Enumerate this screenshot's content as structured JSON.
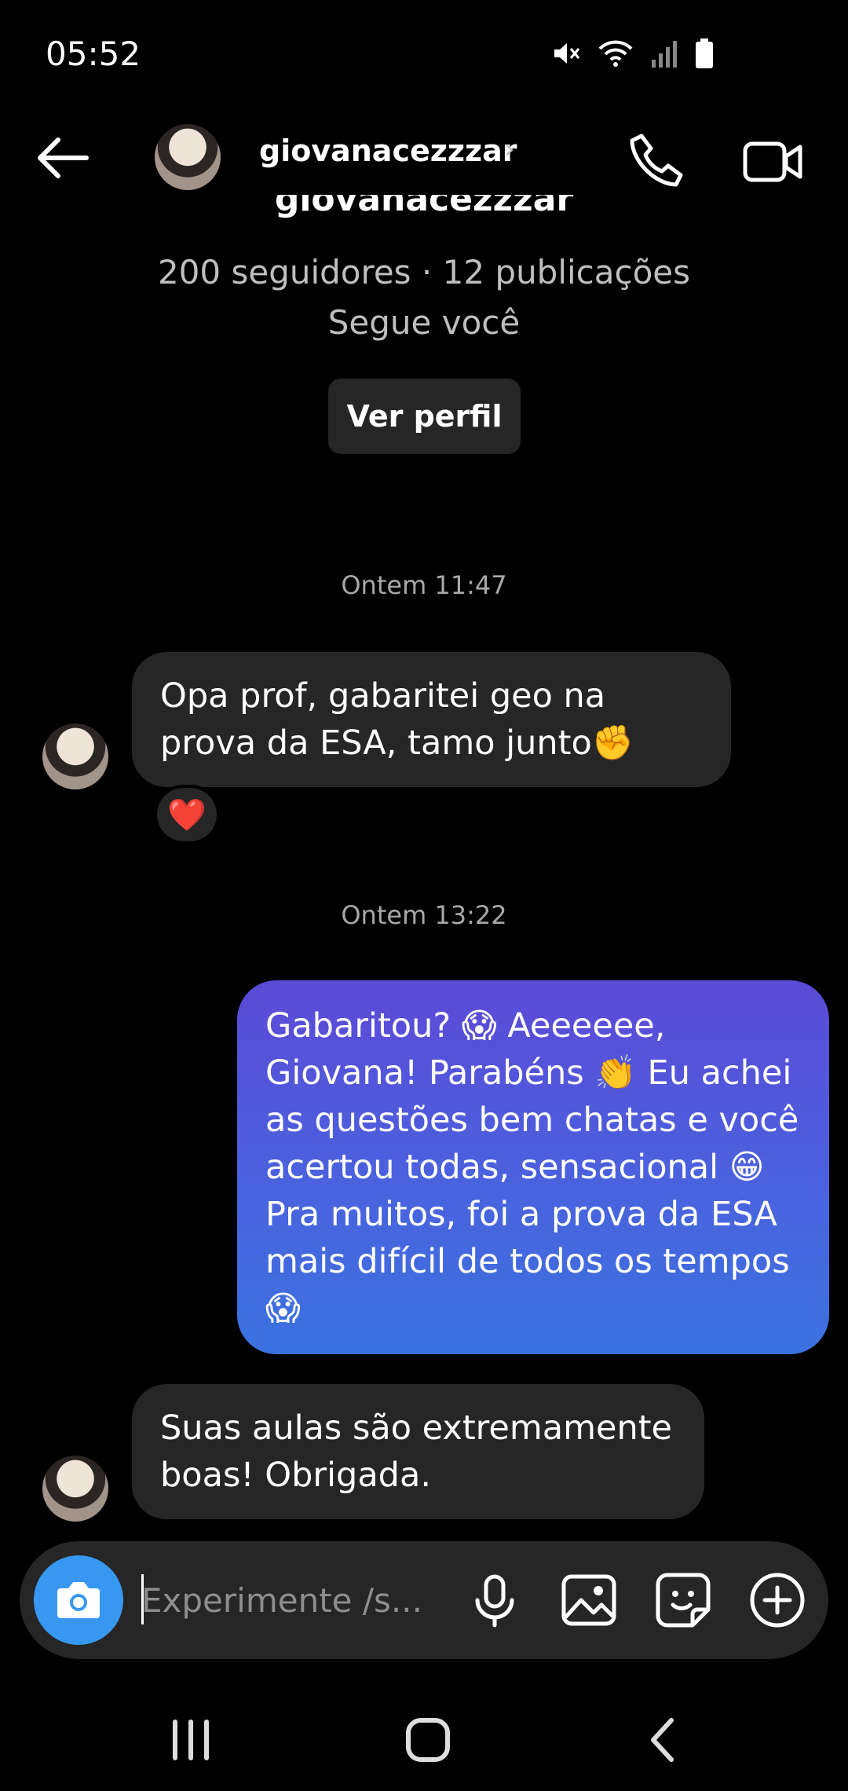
{
  "status_bar": {
    "time": "05:52",
    "icons": [
      "mute-icon",
      "wifi-icon",
      "signal-icon",
      "battery-icon"
    ]
  },
  "header": {
    "username": "giovanacezzzar",
    "chevron": "›",
    "icons": [
      "back-arrow-icon",
      "phone-icon",
      "video-icon"
    ]
  },
  "profile": {
    "name": "giovanacezzzar",
    "stats": "200 seguidores · 12 publicações",
    "follows": "Segue você",
    "view_profile_label": "Ver perfil"
  },
  "conversation": {
    "timestamps": [
      "Ontem 11:47",
      "Ontem 13:22"
    ],
    "messages": [
      {
        "direction": "incoming",
        "text": "Opa prof, gabaritei geo na prova da ESA, tamo junto✊",
        "reaction": "❤️"
      },
      {
        "direction": "outgoing",
        "text": "Gabaritou? 😱 Aeeeeee, Giovana! Parabéns 👏 Eu achei as questões bem chatas e você acertou todas, sensacional 😁 Pra muitos, foi a prova da ESA mais difícil de todos os tempos 😱"
      },
      {
        "direction": "incoming",
        "text": "Suas aulas são extremamente boas! Obrigada."
      }
    ]
  },
  "composer": {
    "placeholder": "Experimente /s...",
    "icons": [
      "camera-icon",
      "microphone-icon",
      "image-icon",
      "sticker-icon",
      "plus-icon"
    ]
  },
  "nav": {
    "icons": [
      "recent-apps-icon",
      "home-icon",
      "back-icon"
    ]
  },
  "colors": {
    "background": "#000000",
    "incoming_bubble": "#262626",
    "outgoing_gradient_top": "#5b4ad6",
    "outgoing_gradient_bottom": "#3b72e0",
    "camera_button": "#3897f0"
  }
}
